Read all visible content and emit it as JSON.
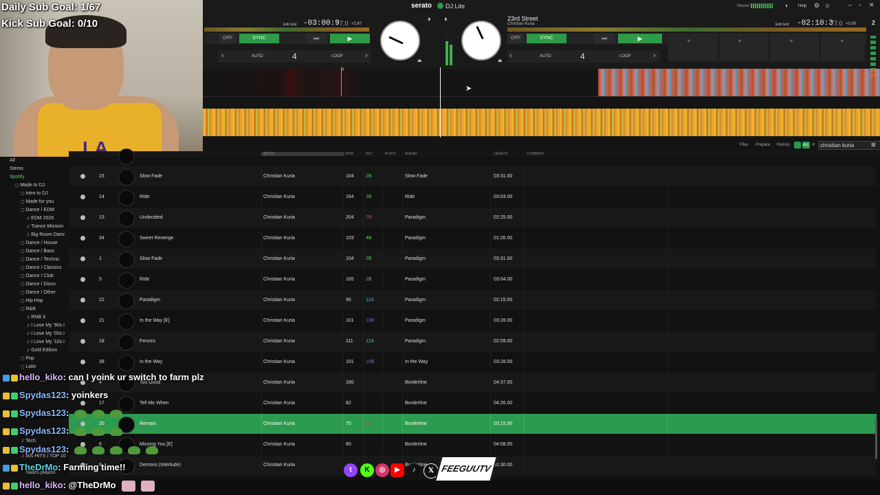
{
  "overlay": {
    "daily_sub_goal": "Daily Sub Goal: 1/67",
    "kick_sub_goal": "Kick Sub Goal: 0/10",
    "jersey_text": "LA"
  },
  "app": {
    "brand": "serato",
    "product": "DJ Lite",
    "master_label": "Master",
    "help_label": "Help"
  },
  "deck_left": {
    "time": "-03:00:9",
    "bpm": "77.0",
    "pitch": "+2.67",
    "edit_grid": "Edit Grid",
    "sync": "SYNC",
    "off": "OFF",
    "auto": "AUTO",
    "loop": "LOOP",
    "loop_value": "4",
    "beat_marker": "5"
  },
  "deck_right": {
    "title": "23rd Street",
    "artist": "Christian Kuria",
    "time": "-02:10:3",
    "bpm": "77.0",
    "pitch": "+0.00",
    "edit_grid": "Edit Grid",
    "sync": "SYNC",
    "off": "OFF",
    "auto": "AUTO",
    "loop": "LOOP",
    "loop_value": "4",
    "deck_number": "2"
  },
  "library": {
    "toolbar": {
      "files": "Files",
      "prepare": "Prepare",
      "history": "History",
      "all": "ALL"
    },
    "search": {
      "value": "christian kuria"
    },
    "columns": {
      "artist": "ARTIST",
      "bpm": "BPM",
      "key": "KEY",
      "plays": "PLAYS",
      "album": "ALBUM",
      "length": "LENGTH",
      "comment": "COMMENT"
    }
  },
  "sidebar": {
    "items": [
      {
        "label": "All"
      },
      {
        "label": "Stems"
      },
      {
        "label": "Spotify"
      },
      {
        "label": "Made to DJ"
      },
      {
        "label": "Intro to DJ"
      },
      {
        "label": "Made for you"
      },
      {
        "label": "Dance / EDM"
      },
      {
        "label": "EDM 2026"
      },
      {
        "label": "Trance Mission"
      },
      {
        "label": "Big Room Danc"
      },
      {
        "label": "Dance / House"
      },
      {
        "label": "Dance / Bass"
      },
      {
        "label": "Dance / Techno"
      },
      {
        "label": "Dance / Classics"
      },
      {
        "label": "Dance / Club"
      },
      {
        "label": "Dance / Disco"
      },
      {
        "label": "Dance / Other"
      },
      {
        "label": "Hip Hop"
      },
      {
        "label": "R&B"
      },
      {
        "label": "RNB X"
      },
      {
        "label": "I Love My '90s I"
      },
      {
        "label": "I Love My '00s I"
      },
      {
        "label": "I Love My '10s I"
      },
      {
        "label": "Gold Edition"
      },
      {
        "label": "Pop"
      },
      {
        "label": "Latin"
      },
      {
        "label": "Tech"
      },
      {
        "label": "80s HITS | TOP 10"
      },
      {
        "label": "hades playlist"
      }
    ]
  },
  "tracks": [
    {
      "num": "23",
      "title": "Slow Fade",
      "artist": "Christian Kuria",
      "bpm": "104",
      "key": "2B",
      "album": "Slow Fade",
      "length": "03:31.00"
    },
    {
      "num": "14",
      "title": "Ride",
      "artist": "Christian Kuria",
      "bpm": "164",
      "key": "2B",
      "album": "Ride",
      "length": "03:03.00"
    },
    {
      "num": "13",
      "title": "Undecided",
      "artist": "Christian Kuria",
      "bpm": "204",
      "key": "7B",
      "album": "Paradigm",
      "length": "02:25.00"
    },
    {
      "num": "34",
      "title": "Sweet Revenge",
      "artist": "Christian Kuria",
      "bpm": "103",
      "key": "4B",
      "album": "Paradigm",
      "length": "01:26.00"
    },
    {
      "num": "1",
      "title": "Slow Fade",
      "artist": "Christian Kuria",
      "bpm": "104",
      "key": "2B",
      "album": "Paradigm",
      "length": "03:31.00"
    },
    {
      "num": "5",
      "title": "Ride",
      "artist": "Christian Kuria",
      "bpm": "165",
      "key": "2B",
      "album": "Paradigm",
      "length": "03:04.00"
    },
    {
      "num": "22",
      "title": "Paradigm",
      "artist": "Christian Kuria",
      "bpm": "95",
      "key": "11A",
      "album": "Paradigm",
      "length": "02:15.00"
    },
    {
      "num": "21",
      "title": "In the Way [E]",
      "artist": "Christian Kuria",
      "bpm": "101",
      "key": "10B",
      "album": "Paradigm",
      "length": "03:28.00"
    },
    {
      "num": "18",
      "title": "Fences",
      "artist": "Christian Kuria",
      "bpm": "111",
      "key": "12A",
      "album": "Paradigm",
      "length": "02:59.00"
    },
    {
      "num": "38",
      "title": "In the Way",
      "artist": "Christian Kuria",
      "bpm": "101",
      "key": "10B",
      "album": "In the Way",
      "length": "03:28.00"
    },
    {
      "num": "4",
      "title": "Too Good",
      "artist": "Christian Kuria",
      "bpm": "160",
      "key": "",
      "album": "Borderline",
      "length": "04:37.00"
    },
    {
      "num": "17",
      "title": "Tell Me When",
      "artist": "Christian Kuria",
      "bpm": "82",
      "key": "",
      "album": "Borderline",
      "length": "04:26.00"
    },
    {
      "num": "20",
      "title": "Remain",
      "artist": "Christian Kuria",
      "bpm": "75",
      "key": "8A",
      "album": "Borderline",
      "length": "03:15.00"
    },
    {
      "num": "6",
      "title": "Missing You [E]",
      "artist": "Christian Kuria",
      "bpm": "80",
      "key": "",
      "album": "Borderline",
      "length": "04:08.00"
    },
    {
      "num": "8",
      "title": "Demons (Interlude)",
      "artist": "Christian Kuria",
      "bpm": "",
      "key": "",
      "album": "Borderline",
      "length": "01:30.00"
    }
  ],
  "chat": [
    {
      "user": "hello_kiko",
      "msg": ": can I yoink ur switch to farm plz"
    },
    {
      "user": "Spydas123",
      "msg": ": yoinkers"
    },
    {
      "user": "Spydas123",
      "msg": ":"
    },
    {
      "user": "Spydas123",
      "msg": ":"
    },
    {
      "user": "Spydas123",
      "msg": ":"
    },
    {
      "user": "TheDrMo",
      "msg": ": Farming time!!"
    },
    {
      "user": "hello_kiko",
      "msg": ": @TheDrMo"
    }
  ],
  "socials": {
    "brand": "FEEGUUTV",
    "icons": [
      "twitch-icon",
      "kick-icon",
      "instagram-icon",
      "youtube-icon",
      "tiktok-icon",
      "x-icon"
    ]
  },
  "colors": {
    "accent": "#2c9a4f",
    "background": "#121212"
  }
}
